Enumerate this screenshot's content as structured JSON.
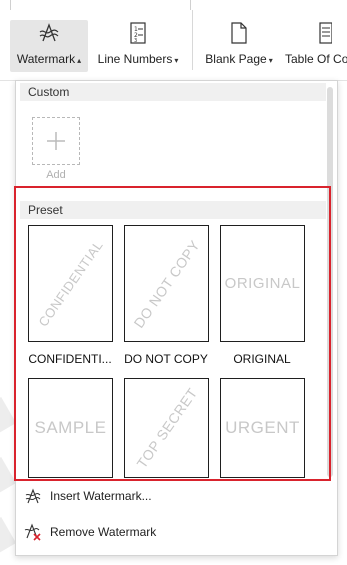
{
  "ribbon": {
    "watermark_label": "Watermark",
    "line_numbers_label": "Line Numbers",
    "blank_page_label": "Blank Page",
    "toc_label": "Table Of Co"
  },
  "dropdown": {
    "custom_header": "Custom",
    "add_label": "Add",
    "preset_header": "Preset",
    "presets": [
      {
        "label": "CONFIDENTI...",
        "mark": "CONFIDENTIAL"
      },
      {
        "label": "DO NOT COPY",
        "mark": "DO NOT COPY"
      },
      {
        "label": "ORIGINAL",
        "mark": "ORIGINAL"
      },
      {
        "label": "",
        "mark": "SAMPLE"
      },
      {
        "label": "",
        "mark": "TOP SECRET"
      },
      {
        "label": "",
        "mark": "URGENT"
      }
    ],
    "insert_label": "Insert Watermark...",
    "remove_label": "Remove Watermark"
  },
  "colors": {
    "highlight": "#d9232d",
    "selected_bg": "#e6e6e6",
    "watermark_text": "#c8c8c8"
  },
  "icons": [
    "watermark-icon",
    "line-numbers-icon",
    "blank-page-icon",
    "table-of-contents-icon",
    "add-icon",
    "insert-watermark-icon",
    "remove-watermark-icon"
  ]
}
